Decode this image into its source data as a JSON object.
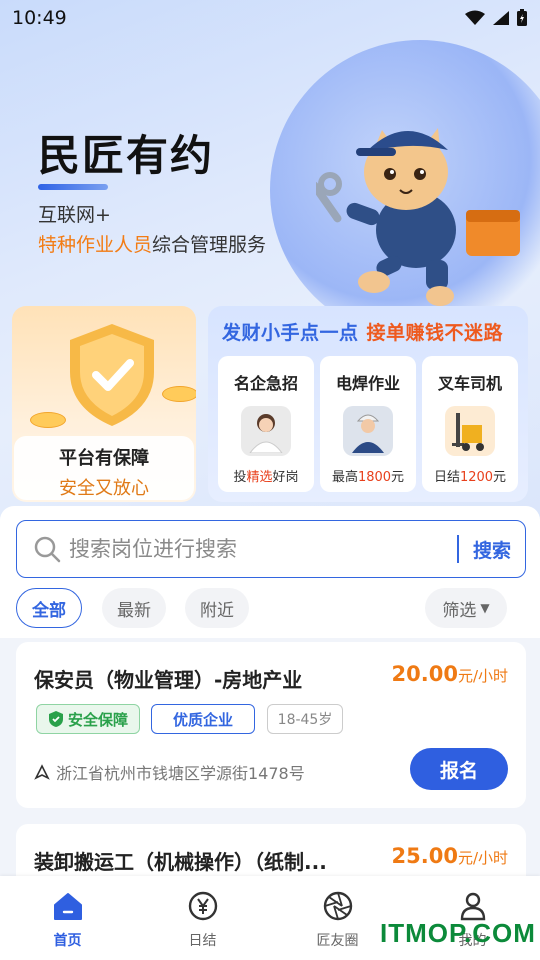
{
  "status_bar": {
    "time": "10:49"
  },
  "hero": {
    "title": "民匠有约",
    "line1": "互联网+",
    "line2_highlight": "特种作业人员",
    "line2_rest": "综合管理服务"
  },
  "guarantee": {
    "title": "平台有保障",
    "subtitle": "安全又放心"
  },
  "promo": {
    "head_left": "发财小手点一点",
    "head_right": "接单赚钱不迷路",
    "cards": [
      {
        "title": "名企急招",
        "sub_pre": "投",
        "sub_red": "精选",
        "sub_post": "好岗"
      },
      {
        "title": "电焊作业",
        "sub_pre": "最高",
        "sub_red": "1800",
        "sub_post": "元"
      },
      {
        "title": "叉车司机",
        "sub_pre": "日结",
        "sub_red": "1200",
        "sub_post": "元"
      }
    ]
  },
  "search": {
    "placeholder": "搜索岗位进行搜索",
    "button": "搜索"
  },
  "filters": {
    "all": "全部",
    "latest": "最新",
    "nearby": "附近",
    "filter": "筛选"
  },
  "jobs": [
    {
      "title": "保安员（物业管理）-房地产业",
      "pay": "20.00",
      "unit": "元/小时",
      "tag_safe": "安全保障",
      "tag_quality": "优质企业",
      "tag_age": "18-45岁",
      "address": "浙江省杭州市钱塘区学源街1478号",
      "button": "报名"
    },
    {
      "title": "装卸搬运工（机械操作）（纸制...",
      "pay": "25.00",
      "unit": "元/小时"
    }
  ],
  "nav": {
    "home": "首页",
    "daily": "日结",
    "circle": "匠友圈",
    "mine": "我的"
  },
  "watermark": "ITMOP.COM",
  "colors": {
    "primary": "#2f5fe0",
    "orange": "#ef7a14",
    "green": "#2aa14b"
  }
}
